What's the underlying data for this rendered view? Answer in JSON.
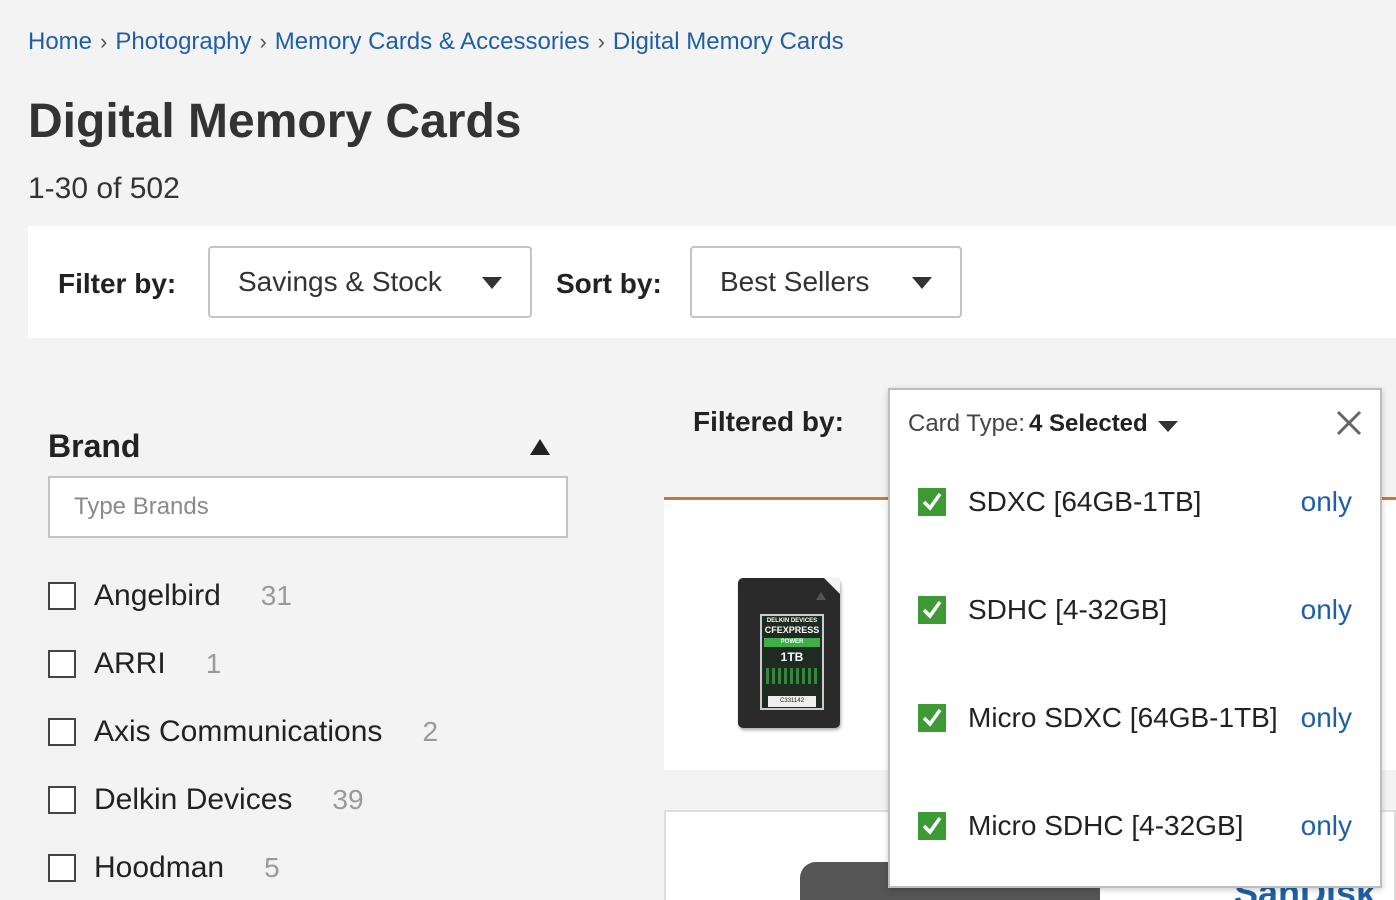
{
  "breadcrumb": {
    "items": [
      "Home",
      "Photography",
      "Memory Cards & Accessories",
      "Digital Memory Cards"
    ],
    "separator": "›"
  },
  "page": {
    "title": "Digital Memory Cards",
    "result_count": "1-30 of 502"
  },
  "filter_bar": {
    "filter_label": "Filter by:",
    "filter_value": "Savings & Stock",
    "sort_label": "Sort by:",
    "sort_value": "Best Sellers"
  },
  "sidebar": {
    "heading": "Brand",
    "search_placeholder": "Type Brands",
    "brands": [
      {
        "name": "Angelbird",
        "count": "31"
      },
      {
        "name": "ARRI",
        "count": "1"
      },
      {
        "name": "Axis Communications",
        "count": "2"
      },
      {
        "name": "Delkin Devices",
        "count": "39"
      },
      {
        "name": "Hoodman",
        "count": "5"
      }
    ]
  },
  "filtered_by": {
    "label": "Filtered by:"
  },
  "dropdown": {
    "label": "Card Type:",
    "selected": "4 Selected",
    "only_label": "only",
    "options": [
      {
        "name": "SDXC [64GB-1TB]",
        "checked": true
      },
      {
        "name": "SDHC [4-32GB]",
        "checked": true
      },
      {
        "name": "Micro SDXC [64GB-1TB]",
        "checked": true
      },
      {
        "name": "Micro SDHC [4-32GB]",
        "checked": true
      }
    ]
  },
  "products": {
    "first_image": {
      "manufacturer": "DELKIN DEVICES",
      "format": "CFEXPRESS",
      "line": "POWER",
      "capacity": "1TB",
      "serial": "C331142"
    },
    "second_brand_text": "SanDisk"
  },
  "colors": {
    "link": "#1f5fa6",
    "accent_line": "#c8773c",
    "check_green": "#3d9a35",
    "background": "#f3f3f3"
  }
}
